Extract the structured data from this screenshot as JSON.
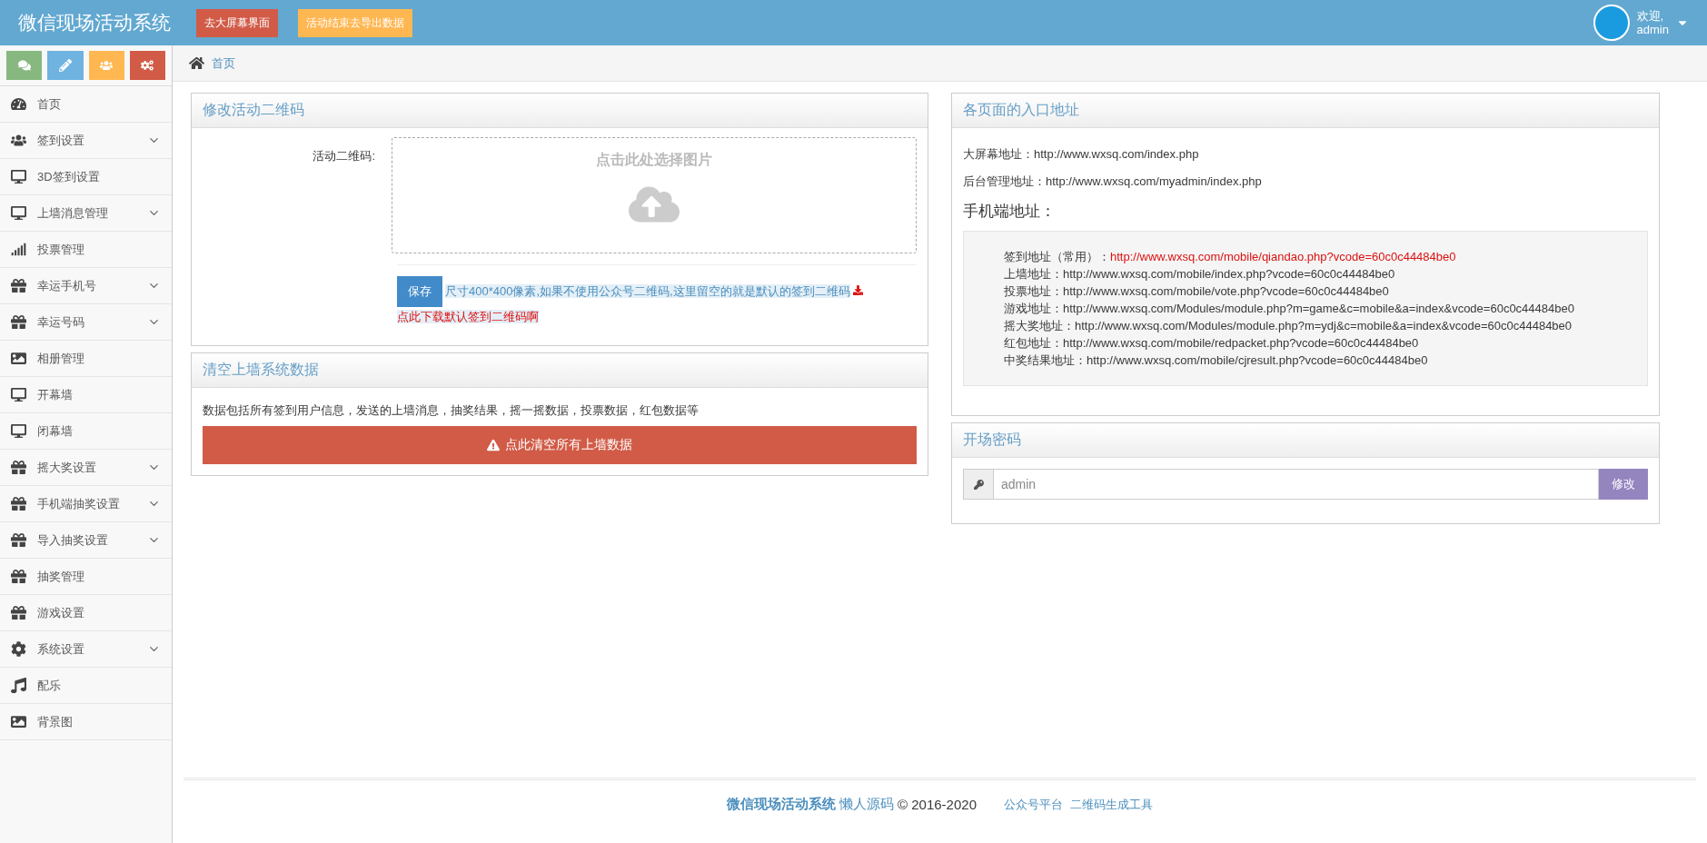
{
  "header": {
    "title": "微信现场活动系统",
    "buttons": [
      {
        "label": "去大屏幕界面",
        "kind": "danger"
      },
      {
        "label": "活动结束去导出数据",
        "kind": "warning"
      }
    ],
    "user": {
      "greeting": "欢迎,",
      "name": "admin"
    }
  },
  "shortcuts": [
    {
      "kind": "comments"
    },
    {
      "kind": "pencil"
    },
    {
      "kind": "users"
    },
    {
      "kind": "cogs"
    }
  ],
  "sidebar": {
    "items": [
      {
        "label": "首页",
        "kind": "dashboard",
        "expandable": false
      },
      {
        "label": "签到设置",
        "kind": "users",
        "expandable": true
      },
      {
        "label": "3D签到设置",
        "kind": "desktop",
        "expandable": false
      },
      {
        "label": "上墙消息管理",
        "kind": "desktop",
        "expandable": true
      },
      {
        "label": "投票管理",
        "kind": "signal",
        "expandable": false
      },
      {
        "label": "幸运手机号",
        "kind": "gift",
        "expandable": true
      },
      {
        "label": "幸运号码",
        "kind": "gift",
        "expandable": true
      },
      {
        "label": "相册管理",
        "kind": "image",
        "expandable": false
      },
      {
        "label": "开幕墙",
        "kind": "desktop",
        "expandable": false
      },
      {
        "label": "闭幕墙",
        "kind": "desktop",
        "expandable": false
      },
      {
        "label": "摇大奖设置",
        "kind": "gift",
        "expandable": true
      },
      {
        "label": "手机端抽奖设置",
        "kind": "gift",
        "expandable": true
      },
      {
        "label": "导入抽奖设置",
        "kind": "gift",
        "expandable": true
      },
      {
        "label": "抽奖管理",
        "kind": "gift",
        "expandable": false
      },
      {
        "label": "游戏设置",
        "kind": "gift",
        "expandable": false
      },
      {
        "label": "系统设置",
        "kind": "cog",
        "expandable": true
      },
      {
        "label": "配乐",
        "kind": "music",
        "expandable": false
      },
      {
        "label": "背景图",
        "kind": "image",
        "expandable": false
      }
    ]
  },
  "breadcrumb": "首页",
  "qrcode_panel": {
    "title": "修改活动二维码",
    "field_label": "活动二维码:",
    "upload_hint": "点击此处选择图片",
    "save": "保存",
    "note": "尺寸400*400像素,如果不使用公众号二维码,这里留空的就是默认的签到二维码",
    "download_link": "点此下载默认签到二维码啊"
  },
  "clear_panel": {
    "title": "清空上墙系统数据",
    "description": "数据包括所有签到用户信息，发送的上墙消息，抽奖结果，摇一摇数据，投票数据，红包数据等",
    "button": "点此清空所有上墙数据"
  },
  "entry_panel": {
    "title": "各页面的入口地址",
    "addresses": [
      {
        "label": "大屏幕地址：",
        "url": "http://www.wxsq.com/index.php"
      },
      {
        "label": "后台管理地址：",
        "url": "http://www.wxsq.com/myadmin/index.php"
      }
    ],
    "mobile_heading": "手机端地址：",
    "mobile": [
      {
        "label": "签到地址（常用）：",
        "url": "http://www.wxsq.com/mobile/qiandao.php?vcode=60c0c44484be0",
        "highlight": true
      },
      {
        "label": "上墙地址：",
        "url": "http://www.wxsq.com/mobile/index.php?vcode=60c0c44484be0",
        "highlight": false
      },
      {
        "label": "投票地址：",
        "url": "http://www.wxsq.com/mobile/vote.php?vcode=60c0c44484be0",
        "highlight": false
      },
      {
        "label": "游戏地址：",
        "url": "http://www.wxsq.com/Modules/module.php?m=game&c=mobile&a=index&vcode=60c0c44484be0",
        "highlight": false
      },
      {
        "label": "摇大奖地址：",
        "url": "http://www.wxsq.com/Modules/module.php?m=ydj&c=mobile&a=index&vcode=60c0c44484be0",
        "highlight": false
      },
      {
        "label": "红包地址：",
        "url": "http://www.wxsq.com/mobile/redpacket.php?vcode=60c0c44484be0",
        "highlight": false
      },
      {
        "label": "中奖结果地址：",
        "url": "http://www.wxsq.com/mobile/cjresult.php?vcode=60c0c44484be0",
        "highlight": false
      }
    ]
  },
  "password_panel": {
    "title": "开场密码",
    "value": "admin",
    "button": "修改"
  },
  "footer": {
    "brand": "微信现场活动系统",
    "source": "懒人源码",
    "copyright": "© 2016-2020",
    "links": [
      "公众号平台",
      "二维码生成工具"
    ]
  }
}
